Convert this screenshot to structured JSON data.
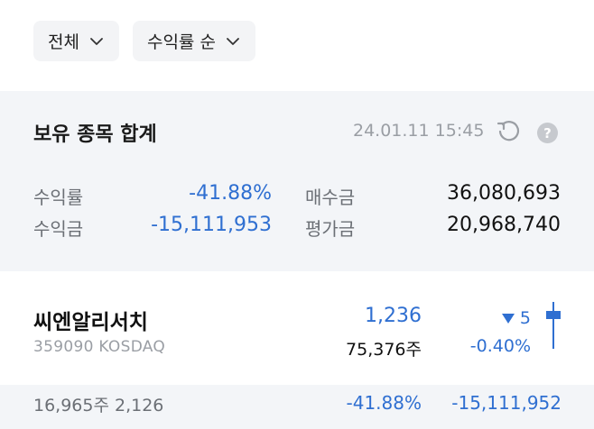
{
  "filters": {
    "scope_label": "전체",
    "sort_label": "수익률 순"
  },
  "summary": {
    "title": "보유 종목 합계",
    "timestamp": "24.01.11 15:45",
    "return_rate_label": "수익률",
    "return_rate_value": "-41.88%",
    "profit_label": "수익금",
    "profit_value": "-15,111,953",
    "purchase_label": "매수금",
    "purchase_value": "36,080,693",
    "valuation_label": "평가금",
    "valuation_value": "20,968,740",
    "help_symbol": "?"
  },
  "stock": {
    "name": "씨엔알리서치",
    "code_market": "359090  KOSDAQ",
    "price": "1,236",
    "quantity": "75,376주",
    "change": "5",
    "change_pct": "-0.40%"
  },
  "holding_row": {
    "shares_avg": "16,965주 2,126",
    "return_rate": "-41.88%",
    "profit": "-15,111,952"
  },
  "colors": {
    "down_blue": "#2f6fd1",
    "card_bg": "#f3f5f8"
  },
  "icons": [
    "chevron-down-icon",
    "refresh-icon",
    "help-icon",
    "down-triangle-icon",
    "candle-icon"
  ]
}
